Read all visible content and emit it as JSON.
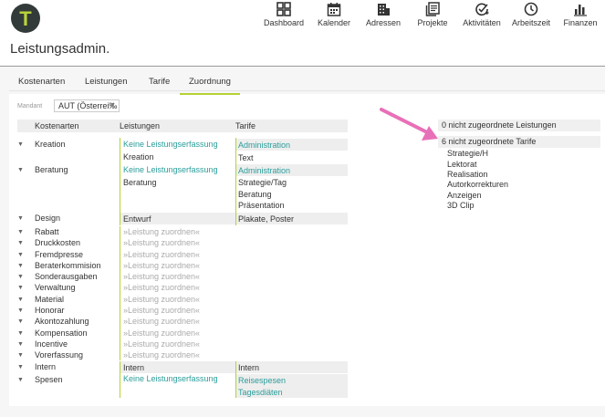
{
  "app": {
    "logo_letter": "T",
    "page_title": "Leistungsadmin."
  },
  "nav": [
    {
      "label": "Dashboard",
      "icon": "dashboard-icon"
    },
    {
      "label": "Kalender",
      "icon": "calendar-icon"
    },
    {
      "label": "Adressen",
      "icon": "building-icon"
    },
    {
      "label": "Projekte",
      "icon": "projects-icon"
    },
    {
      "label": "Aktivitäten",
      "icon": "activity-icon"
    },
    {
      "label": "Arbeitszeit",
      "icon": "clock-icon"
    },
    {
      "label": "Finanzen",
      "icon": "bar-chart-icon"
    }
  ],
  "tabs": [
    "Kostenarten",
    "Leistungen",
    "Tarife",
    "Zuordnung"
  ],
  "active_tab": "Zuordnung",
  "mandant": {
    "label": "Mandant",
    "value": "AUT (Österrei‰"
  },
  "columns": {
    "kostenarten": "Kostenarten",
    "leistungen": "Leistungen",
    "tarife": "Tarife"
  },
  "rows": {
    "kreation": {
      "name": "Kreation",
      "l1": "Keine Leistungserfassung",
      "l2": "Kreation",
      "t1": "Administration",
      "t2": "Text"
    },
    "beratung": {
      "name": "Beratung",
      "l1": "Keine Leistungserfassung",
      "l2": "Beratung",
      "t1": "Administration",
      "t2": "Strategie/Tag",
      "t3": "Beratung",
      "t4": "Präsentation"
    },
    "design": {
      "name": "Design",
      "l1": "Entwurf",
      "t1": "Plakate, Poster"
    },
    "placeholder": "»Leistung zuordnen«",
    "simple": [
      "Rabatt",
      "Druckkosten",
      "Fremdpresse",
      "Beraterkommision",
      "Sonderausgaben",
      "Verwaltung",
      "Material",
      "Honorar",
      "Akontozahlung",
      "Kompensation",
      "Incentive",
      "Vorerfassung"
    ],
    "intern": {
      "name": "Intern",
      "l1": "Intern",
      "t1": "Intern"
    },
    "spesen": {
      "name": "Spesen",
      "l1": "Keine Leistungserfassung",
      "t1": "Reisespesen",
      "t2": "Tagesdiäten"
    }
  },
  "right": {
    "unassigned_services": "0 nicht zugeordnete Leistungen",
    "unassigned_tariffs": "6 nicht zugeordnete Tarife",
    "tariffs": [
      "Strategie/H",
      "Lektorat",
      "Realisation",
      "Autorkorrekturen",
      "Anzeigen",
      "3D Clip"
    ]
  },
  "colors": {
    "accent": "#b5d334",
    "link": "#2a9d9a",
    "arrow": "#e870b8"
  }
}
